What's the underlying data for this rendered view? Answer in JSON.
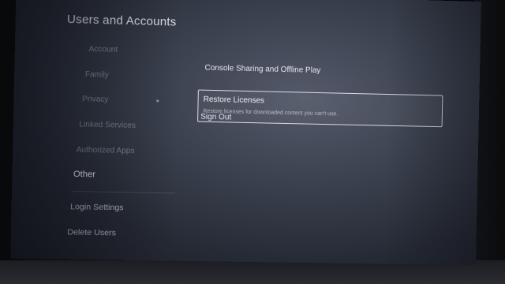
{
  "header": {
    "title": "Users and Accounts"
  },
  "sidebar": {
    "items": [
      {
        "label": "Account"
      },
      {
        "label": "Family"
      },
      {
        "label": "Privacy"
      },
      {
        "label": "Linked Services"
      },
      {
        "label": "Authorized Apps"
      },
      {
        "label": "Other",
        "active": true
      },
      {
        "label": "Login Settings"
      },
      {
        "label": "Delete Users"
      }
    ]
  },
  "main": {
    "options": [
      {
        "label": "Console Sharing and Offline Play"
      },
      {
        "label": "Restore Licenses",
        "description": "Restore licenses for downloaded content you can't use.",
        "selected": true
      },
      {
        "label": "Sign Out"
      }
    ]
  },
  "colors": {
    "screen_bg": "#3c4250",
    "text_primary": "#e6e8ee",
    "text_dim": "#7f8596",
    "selection_border": "#d9dce4"
  }
}
